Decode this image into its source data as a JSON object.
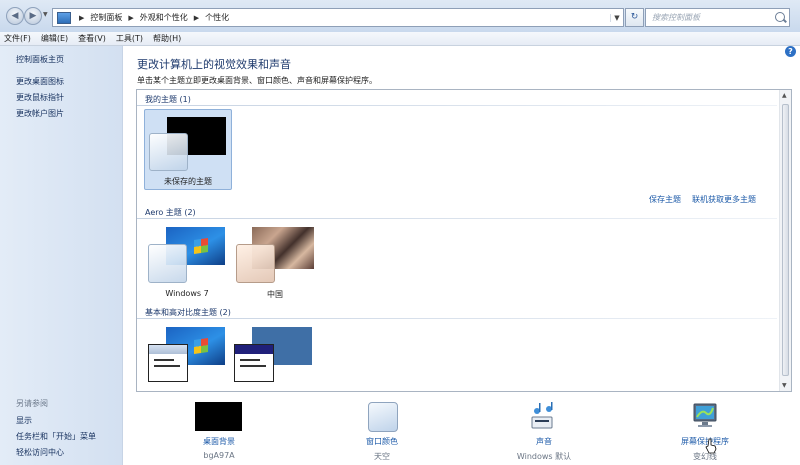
{
  "address_bar": {
    "breadcrumbs": [
      "控制面板",
      "外观和个性化",
      "个性化"
    ],
    "search_placeholder": "搜索控制面板"
  },
  "menu": [
    "文件(F)",
    "编辑(E)",
    "查看(V)",
    "工具(T)",
    "帮助(H)"
  ],
  "left_panel": {
    "home_link": "控制面板主页",
    "links": [
      "更改桌面图标",
      "更改鼠标指针",
      "更改帐户图片"
    ],
    "see_also_header": "另请参阅",
    "see_also": [
      "显示",
      "任务栏和「开始」菜单",
      "轻松访问中心"
    ]
  },
  "main": {
    "title": "更改计算机上的视觉效果和声音",
    "subtitle": "单击某个主题立即更改桌面背景、窗口颜色、声音和屏幕保护程序。",
    "groups": {
      "my_themes": "我的主题 (1)",
      "aero_themes": "Aero 主题 (2)",
      "basic_themes": "基本和高对比度主题 (2)"
    },
    "themes": {
      "unsaved": "未保存的主题",
      "windows7": "Windows 7",
      "china": "中国"
    },
    "links": {
      "save_theme": "保存主题",
      "get_more_themes": "联机获取更多主题"
    }
  },
  "bottom": [
    {
      "label": "桌面背景",
      "value": "bgA97A"
    },
    {
      "label": "窗口颜色",
      "value": "天空"
    },
    {
      "label": "声音",
      "value": "Windows 默认"
    },
    {
      "label": "屏幕保护程序",
      "value": "变幻线"
    }
  ],
  "colors": {
    "link": "#1c5aa8",
    "title": "#1e3a6d",
    "selected_tile": "#cfe0f4",
    "left_panel": "#dae5f3"
  },
  "icons": [
    "back-arrow-icon",
    "forward-arrow-icon",
    "control-panel-icon",
    "refresh-icon",
    "search-icon",
    "help-icon",
    "sound-icon",
    "screensaver-icon",
    "cursor-icon"
  ]
}
